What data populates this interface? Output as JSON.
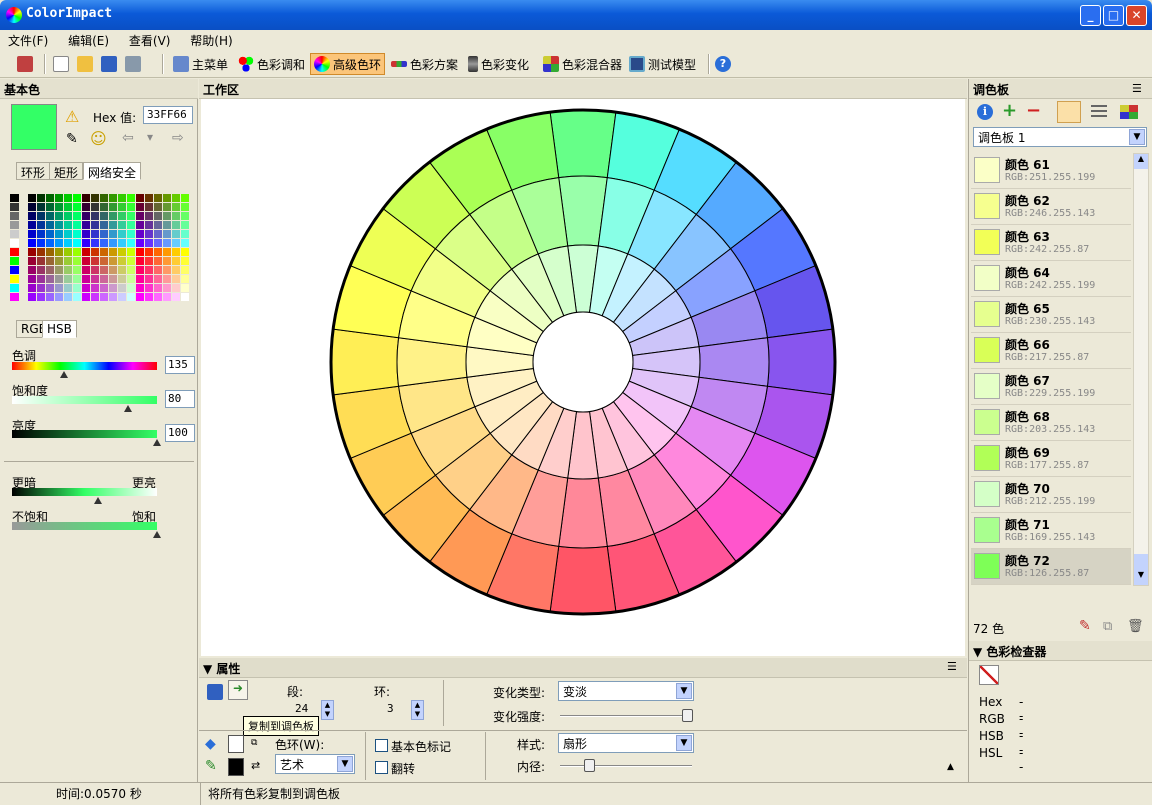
{
  "window": {
    "title": "ColorImpact"
  },
  "menu": [
    "文件(F)",
    "编辑(E)",
    "查看(V)",
    "帮助(H)"
  ],
  "toolbar": {
    "main_menu": "主菜单",
    "color_harmony": "色彩调和",
    "advanced_wheel": "高级色环",
    "color_scheme": "色彩方案",
    "color_variation": "色彩变化",
    "color_mixer": "色彩混合器",
    "test_model": "测试模型"
  },
  "left": {
    "header": "基本色",
    "hex_label": "Hex 值:",
    "hex_value": "33FF66",
    "base_color": "#33ff66",
    "tabs": [
      "环形",
      "矩形",
      "网络安全"
    ],
    "mode_tabs": [
      "RGB",
      "HSB"
    ],
    "hue_label": "色调",
    "hue_value": "135",
    "hue_pos": 0.36,
    "sat_label": "饱和度",
    "sat_value": "80",
    "sat_pos": 0.8,
    "bri_label": "亮度",
    "bri_value": "100",
    "bri_pos": 1.0,
    "darker": "更暗",
    "lighter": "更亮",
    "dl_pos": 0.59,
    "unsat": "不饱和",
    "sat": "饱和",
    "us_pos": 1.0
  },
  "work": {
    "header": "工作区"
  },
  "props": {
    "header": "属性",
    "segments_label": "段:",
    "segments_value": "24",
    "rings_label": "环:",
    "rings_value": "3",
    "vartype_label": "变化类型:",
    "vartype_value": "变淡",
    "varstrength_label": "变化强度:",
    "varstrength_pos": 0.97,
    "wheel_label": "色环(W):",
    "wheel_value": "艺术",
    "mark_base": "基本色标记",
    "flip": "翻转",
    "style_label": "样式:",
    "style_value": "扇形",
    "inner_label": "内径:",
    "inner_pos": 0.23,
    "tooltip": "复制到调色板"
  },
  "right": {
    "header": "调色板",
    "palette_select": "调色板 1",
    "count": "72 色",
    "items": [
      {
        "name": "颜色 61",
        "rgb": "RGB:251.255.199",
        "hex": "#fbffc7"
      },
      {
        "name": "颜色 62",
        "rgb": "RGB:246.255.143",
        "hex": "#f6ff8f"
      },
      {
        "name": "颜色 63",
        "rgb": "RGB:242.255.87",
        "hex": "#f2ff57"
      },
      {
        "name": "颜色 64",
        "rgb": "RGB:242.255.199",
        "hex": "#f2ffc7"
      },
      {
        "name": "颜色 65",
        "rgb": "RGB:230.255.143",
        "hex": "#e6ff8f"
      },
      {
        "name": "颜色 66",
        "rgb": "RGB:217.255.87",
        "hex": "#d9ff57"
      },
      {
        "name": "颜色 67",
        "rgb": "RGB:229.255.199",
        "hex": "#e5ffc7"
      },
      {
        "name": "颜色 68",
        "rgb": "RGB:203.255.143",
        "hex": "#cbff8f"
      },
      {
        "name": "颜色 69",
        "rgb": "RGB:177.255.87",
        "hex": "#b1ff57"
      },
      {
        "name": "颜色 70",
        "rgb": "RGB:212.255.199",
        "hex": "#d4ffc7"
      },
      {
        "name": "颜色 71",
        "rgb": "RGB:169.255.143",
        "hex": "#a9ff8f"
      },
      {
        "name": "颜色 72",
        "rgb": "RGB:126.255.87",
        "hex": "#7eff57"
      }
    ],
    "checker_header": "色彩检查器",
    "checker": [
      {
        "label": "Hex",
        "value": "--"
      },
      {
        "label": "RGB",
        "value": "--"
      },
      {
        "label": "HSB",
        "value": "--"
      },
      {
        "label": "HSL",
        "value": "--"
      }
    ]
  },
  "status": {
    "time": "时间:0.0570 秒",
    "message": "将所有色彩复制到调色板"
  },
  "wheel": {
    "segments": 24,
    "rings": 3,
    "outer": [
      "#66ff88",
      "#55ffdd",
      "#55ddff",
      "#55aaff",
      "#5577ff",
      "#6655ee",
      "#8855ee",
      "#aa55ee",
      "#dd55ee",
      "#ff55cc",
      "#ff5599",
      "#ff5577",
      "#ff5566",
      "#ff7766",
      "#ff9955",
      "#ffbb55",
      "#ffcc55",
      "#ffdd55",
      "#ffee55",
      "#ffff55",
      "#eeff55",
      "#ccff55",
      "#aaff55",
      "#88ff66"
    ],
    "middle": [
      "#99ffaa",
      "#88ffe6",
      "#88e6ff",
      "#88c4ff",
      "#88a2ff",
      "#9988f2",
      "#aa88f2",
      "#c088f2",
      "#e588f2",
      "#ff88dd",
      "#ff88bb",
      "#ff88a0",
      "#ff8899",
      "#ff9e99",
      "#ffb888",
      "#ffd088",
      "#ffdb88",
      "#ffe688",
      "#fff288",
      "#ffff88",
      "#f2ff88",
      "#dbff88",
      "#c4ff88",
      "#aaff99"
    ],
    "inner": [
      "#ccffd5",
      "#c4fff2",
      "#c4f2ff",
      "#c4e2ff",
      "#c4d0ff",
      "#ccc4f9",
      "#d5c4f9",
      "#e0c4f9",
      "#f2c4f9",
      "#ffc4ee",
      "#ffc4dd",
      "#ffc4d0",
      "#ffc4cc",
      "#ffcecc",
      "#ffdbc4",
      "#ffe7c4",
      "#ffedc4",
      "#fff2c4",
      "#fff9c4",
      "#ffffc4",
      "#f9ffc4",
      "#edffc4",
      "#e2ffc4",
      "#d5ffcc"
    ]
  }
}
